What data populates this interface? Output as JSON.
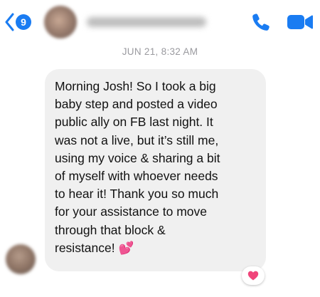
{
  "header": {
    "unread_count": "9",
    "contact_name": "",
    "accent_color": "#1a7cf2",
    "icons": {
      "back": "chevron-left-icon",
      "call": "phone-icon",
      "video": "video-camera-icon"
    }
  },
  "thread": {
    "timestamp": "JUN 21, 8:32 AM",
    "message": {
      "text": "Morning Josh!  So I took a big\nbaby step and posted a video\npublic ally on FB last night.  It\nwas not a live, but it’s still me,\nusing my voice & sharing a bit\nof myself with whoever needs\nto hear it!  Thank you so much\nfor your assistance to move\nthrough that block &\nresistance!  💕",
      "bubble_color": "#f0f0f0",
      "reaction": "heart",
      "reaction_color": "#f0457a"
    }
  }
}
